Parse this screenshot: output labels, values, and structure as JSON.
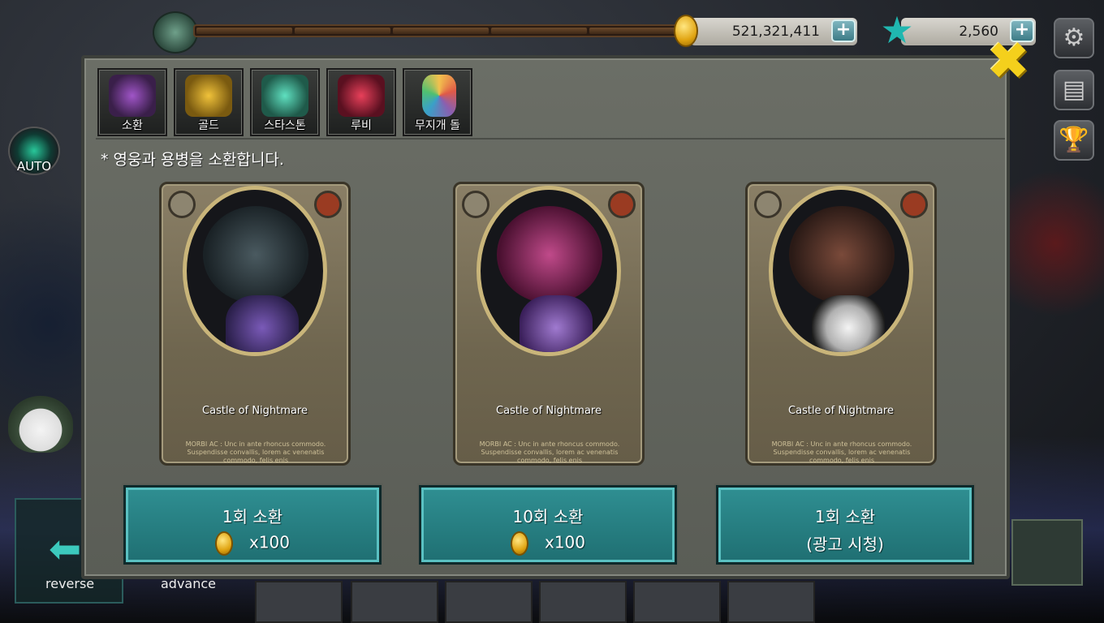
{
  "topbar": {
    "gold_amount": "521,321,411",
    "gem_amount": "2,560",
    "plus_label": "+"
  },
  "side": {
    "auto_label": "AUTO",
    "reverse_label": "reverse",
    "advance_label": "advance"
  },
  "tabs": [
    {
      "label": "소환",
      "art_color": "#7a3fa0"
    },
    {
      "label": "골드",
      "art_color": "#d9a51c"
    },
    {
      "label": "스타스톤",
      "art_color": "#2cb59a"
    },
    {
      "label": "루비",
      "art_color": "#c7263e"
    },
    {
      "label": "무지개 돌",
      "art_color": "#8a6fb0"
    }
  ],
  "panel": {
    "description": "* 영웅과 용병을 소환합니다.",
    "close_glyph": "✖"
  },
  "cards": [
    {
      "name": "Castle of Nightmare",
      "desc": "MORBI AC : Unc in ante rhoncus commodo. Suspendisse convallis, lorem ac venenatis commodo, felis enis",
      "top_color": "#2d3a40",
      "char_color": "#4a3a8a"
    },
    {
      "name": "Castle of Nightmare",
      "desc": "MORBI AC : Unc in ante rhoncus commodo. Suspendisse convallis, lorem ac venenatis commodo, felis enis",
      "top_color": "#8a1f6a",
      "char_color": "#6a3aa0"
    },
    {
      "name": "Castle of Nightmare",
      "desc": "MORBI AC : Unc in ante rhoncus commodo. Suspendisse convallis, lorem ac venenatis commodo, felis enis",
      "top_color": "#3a3030",
      "char_color": "#e8e8e8"
    }
  ],
  "buttons": [
    {
      "title": "1회 소환",
      "cost": "x100",
      "has_coin": true
    },
    {
      "title": "10회 소환",
      "cost": "x100",
      "has_coin": true
    },
    {
      "title": "1회 소환",
      "cost": "(광고 시청)",
      "has_coin": false
    }
  ],
  "icons": {
    "settings": "⚙",
    "book": "▤",
    "trophy": "🏆",
    "star": "★",
    "arrow_left": "⬅"
  }
}
